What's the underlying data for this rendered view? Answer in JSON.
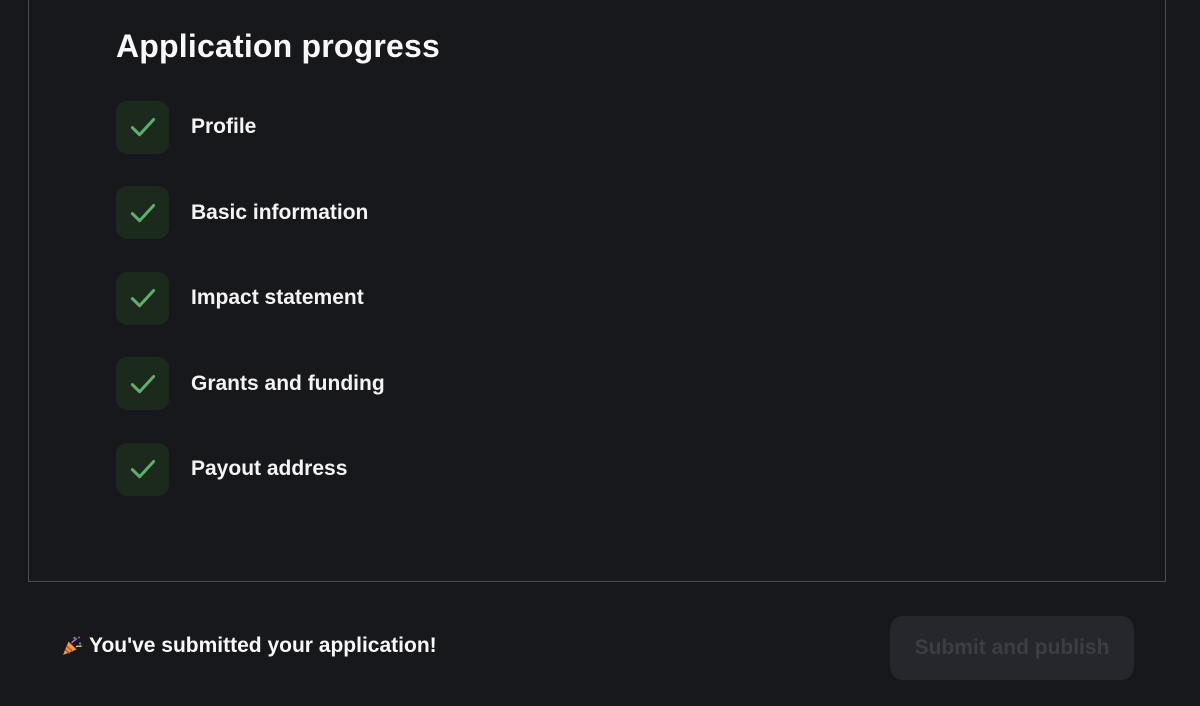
{
  "progress": {
    "title": "Application progress",
    "steps": [
      {
        "label": "Profile",
        "status": "complete"
      },
      {
        "label": "Basic information",
        "status": "complete"
      },
      {
        "label": "Impact statement",
        "status": "complete"
      },
      {
        "label": "Grants and funding",
        "status": "complete"
      },
      {
        "label": "Payout address",
        "status": "complete"
      }
    ]
  },
  "footer": {
    "message_icon": "party-popper-icon",
    "message": "You've submitted your application!",
    "submit_label": "Submit and publish",
    "submit_enabled": false
  },
  "colors": {
    "background": "#17181b",
    "check_green": "#5fae6a",
    "check_bg": "#1b2a1c",
    "button_disabled_bg": "#25272c",
    "button_disabled_text": "#3b3e45"
  }
}
